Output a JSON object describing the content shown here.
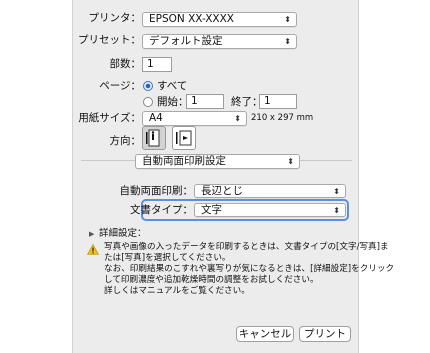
{
  "printer": {
    "label": "プリンタ：",
    "value": "EPSON XX-XXXX"
  },
  "preset": {
    "label": "プリセット：",
    "value": "デフォルト設定"
  },
  "copies": {
    "label": "部数：",
    "value": "1"
  },
  "pages": {
    "label": "ページ：",
    "all_label": "すべて",
    "from_label": "開始：",
    "from_value": "1",
    "to_label": "終了：",
    "to_value": "1",
    "selected": "all"
  },
  "paper_size": {
    "label": "用紙サイズ：",
    "value": "A4",
    "dimensions": "210 x 297 mm"
  },
  "orientation": {
    "label": "方向：",
    "selected": "portrait"
  },
  "panel_select": {
    "value": "自動両面印刷設定"
  },
  "duplex": {
    "label": "自動両面印刷：",
    "value": "長辺とじ"
  },
  "document_type": {
    "label": "文書タイプ：",
    "value": "文字"
  },
  "details": {
    "label": "詳細設定："
  },
  "warning": {
    "lines": [
      "写真や画像の入ったデータを印刷するときは、文書タイプの[文字/写真]ま",
      "たは[写真]を選択してください。",
      "なお、印刷結果のこすれや裏写りが気になるときは、[詳細設定]をクリック",
      "して印刷濃度や追加乾燥時間の調整をお試しください。",
      "詳しくはマニュアルをご覧ください。"
    ],
    "icon_color": "#f2c21b"
  },
  "buttons": {
    "cancel": "キャンセル",
    "print": "プリント"
  },
  "colors": {
    "focus": "#5b8fe0",
    "selected_radio": "#2c5fb5"
  }
}
